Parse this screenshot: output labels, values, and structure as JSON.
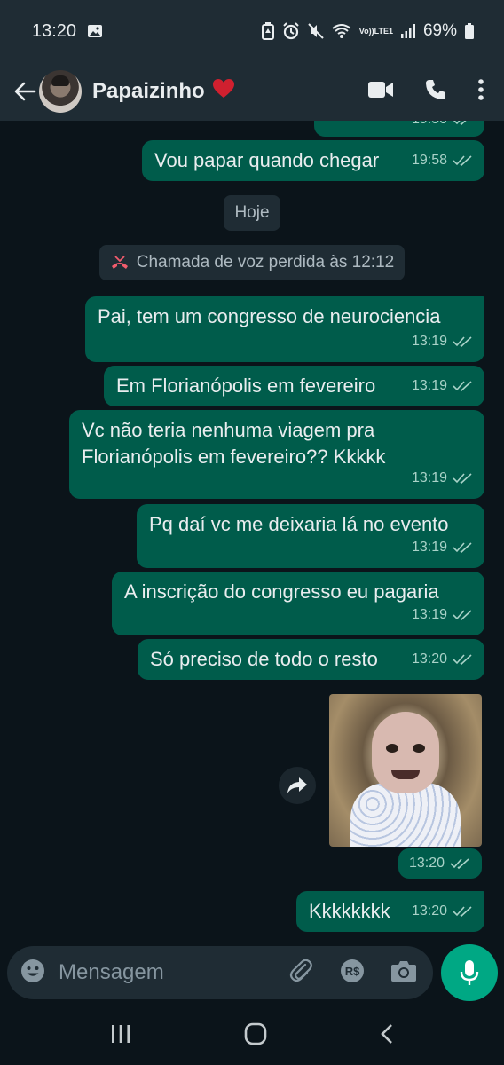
{
  "status_bar": {
    "time": "13:20",
    "network_label_top": "Vo))",
    "network_label_bottom": "LTE1",
    "battery": "69%"
  },
  "header": {
    "contact_name": "Papaizinho",
    "contact_emoji": "❤️"
  },
  "chat": {
    "date_chip": "Hoje",
    "missed_call": "Chamada de voz perdida às 12:12",
    "partial_prev_time": "19:50",
    "messages": [
      {
        "text": "Vou papar quando chegar",
        "time": "19:58"
      },
      {
        "text": "Pai, tem um congresso de neurociencia",
        "time": "13:19"
      },
      {
        "text": "Em Florianópolis em fevereiro",
        "time": "13:19"
      },
      {
        "text": "Vc não teria nenhuma viagem pra\nFlorianópolis em fevereiro?? Kkkkk",
        "time": "13:19"
      },
      {
        "text": "Pq daí vc me deixaria lá no evento",
        "time": "13:19"
      },
      {
        "text": "A inscrição do congresso eu pagaria",
        "time": "13:19"
      },
      {
        "text": "Só preciso de todo o resto",
        "time": "13:20"
      },
      {
        "text": "Kkkkkkkk",
        "time": "13:20"
      }
    ],
    "sticker_time": "13:20"
  },
  "input": {
    "placeholder": "Mensagem"
  },
  "colors": {
    "background": "#0b141a",
    "bar": "#1f2c34",
    "outgoing_bubble": "#005c4b",
    "accent": "#00a884",
    "missed_call_icon": "#f15c6d"
  },
  "icons": [
    "image-icon",
    "battery-saver-icon",
    "alarm-icon",
    "mute-icon",
    "wifi-icon",
    "signal-icon",
    "battery-icon",
    "back-arrow-icon",
    "video-call-icon",
    "voice-call-icon",
    "more-options-icon",
    "missed-call-icon",
    "double-check-icon",
    "forward-icon",
    "emoji-icon",
    "attach-icon",
    "payment-icon",
    "camera-icon",
    "mic-icon",
    "recent-apps-icon",
    "home-icon",
    "nav-back-icon"
  ]
}
